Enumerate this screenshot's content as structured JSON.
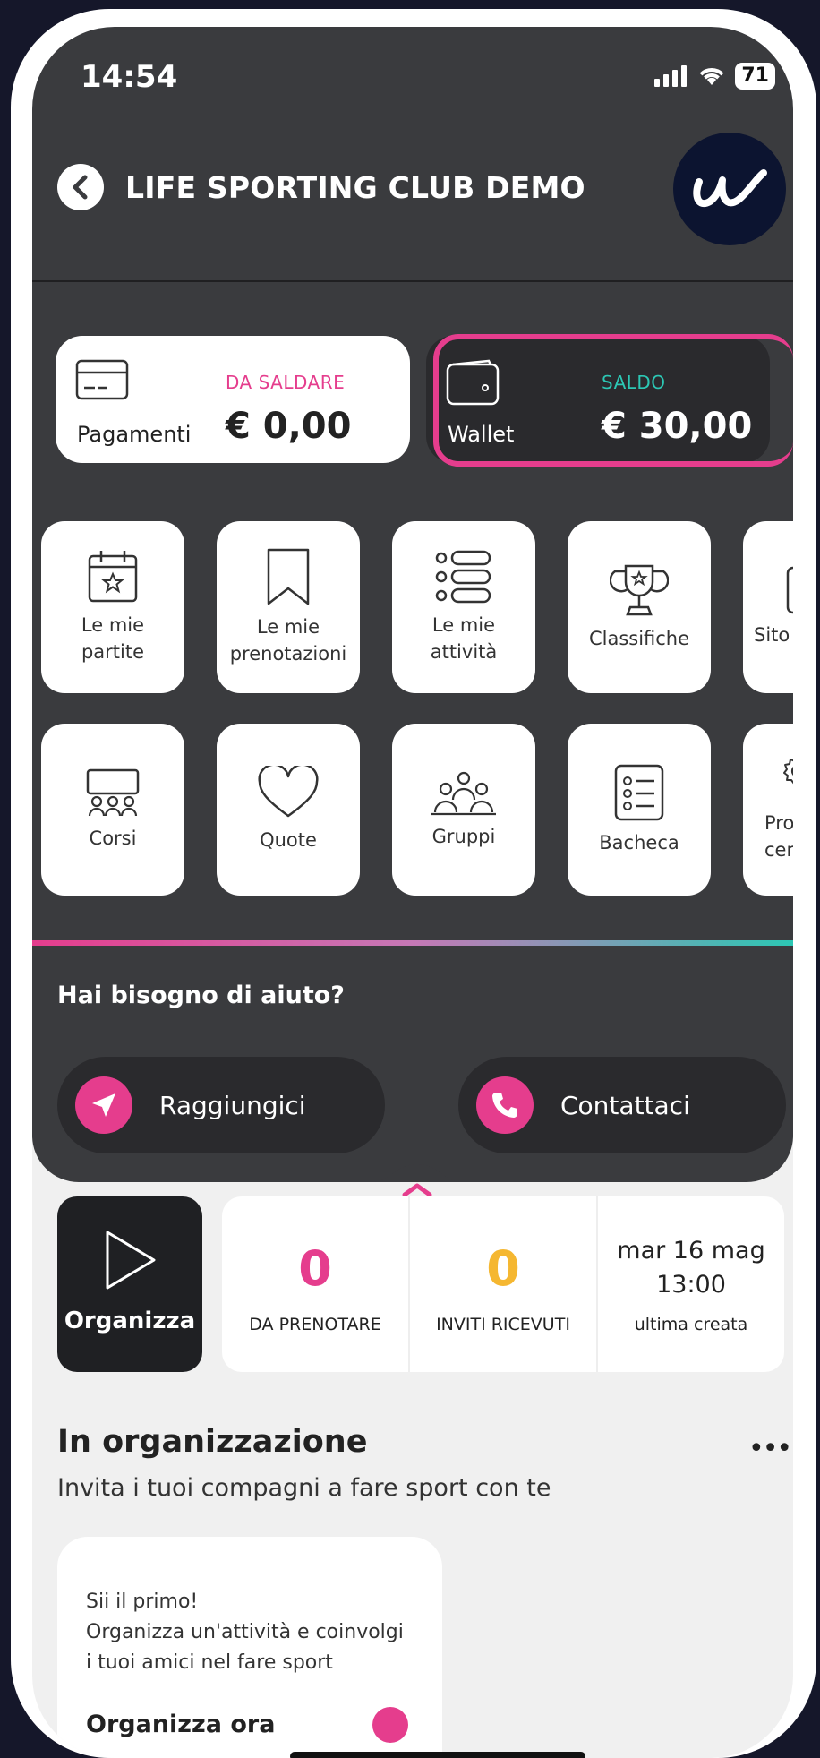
{
  "status_bar": {
    "time": "14:54",
    "battery": "71"
  },
  "header": {
    "title": "LIFE SPORTING CLUB DEMO",
    "logo_text": "w"
  },
  "balance": {
    "payments": {
      "label": "Pagamenti",
      "caption": "DA SALDARE",
      "amount": "€ 0,00"
    },
    "wallet": {
      "label": "Wallet",
      "caption": "SALDO",
      "amount": "€ 30,00"
    }
  },
  "menu_row1": [
    {
      "label": "Le mie\npartite",
      "icon": "calendar-star-icon"
    },
    {
      "label": "Le mie\nprenotazioni",
      "icon": "bookmark-icon"
    },
    {
      "label": "Le mie\nattività",
      "icon": "list-icon"
    },
    {
      "label": "Classifiche",
      "icon": "trophy-icon"
    },
    {
      "label": "Sito de",
      "icon": "website-icon"
    }
  ],
  "menu_row2": [
    {
      "label": "Corsi",
      "icon": "classroom-icon"
    },
    {
      "label": "Quote",
      "icon": "heart-icon"
    },
    {
      "label": "Gruppi",
      "icon": "group-icon"
    },
    {
      "label": "Bacheca",
      "icon": "board-icon"
    },
    {
      "label": "Profil\ncer",
      "icon": "gear-icon"
    }
  ],
  "help": {
    "title": "Hai bisogno di aiuto?",
    "reach_label": "Raggiungici",
    "contact_label": "Contattaci"
  },
  "organize": {
    "label": "Organizza"
  },
  "stats": [
    {
      "value": "0",
      "label": "DA PRENOTARE",
      "color": "#e53d8d"
    },
    {
      "value": "0",
      "label": "INVITI RICEVUTI",
      "color": "#f5b731"
    },
    {
      "date": "mar 16 mag\n13:00",
      "label": "ultima creata"
    }
  ],
  "section": {
    "title": "In organizzazione",
    "subtitle": "Invita i tuoi compagni a fare sport con te",
    "more": "•••"
  },
  "promo": {
    "text": "Sii il primo!\nOrganizza un'attività e coinvolgi\ni tuoi amici nel fare sport",
    "action": "Organizza ora"
  },
  "colors": {
    "accent_pink": "#e53d8d",
    "accent_teal": "#2cc7b4",
    "dark_bg": "#3a3b3e"
  }
}
